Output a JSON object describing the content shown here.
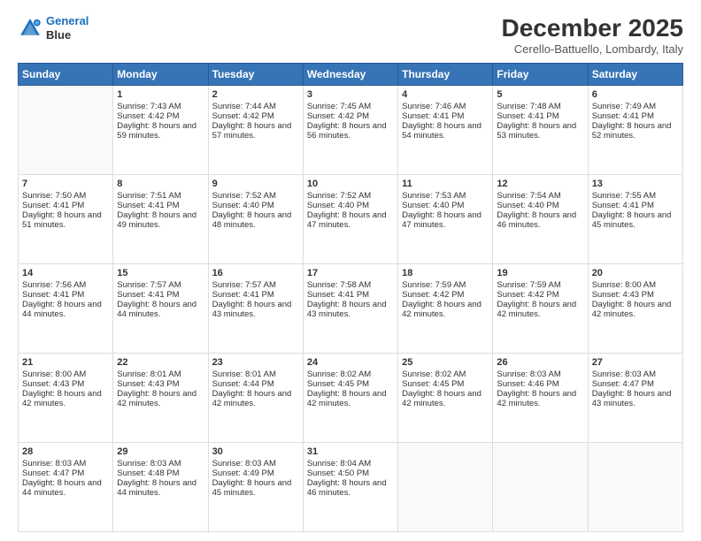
{
  "logo": {
    "line1": "General",
    "line2": "Blue"
  },
  "title": "December 2025",
  "location": "Cerello-Battuello, Lombardy, Italy",
  "days_of_week": [
    "Sunday",
    "Monday",
    "Tuesday",
    "Wednesday",
    "Thursday",
    "Friday",
    "Saturday"
  ],
  "weeks": [
    [
      {
        "day": "",
        "empty": true,
        "sunrise": "",
        "sunset": "",
        "daylight": ""
      },
      {
        "day": "1",
        "sunrise": "Sunrise: 7:43 AM",
        "sunset": "Sunset: 4:42 PM",
        "daylight": "Daylight: 8 hours and 59 minutes."
      },
      {
        "day": "2",
        "sunrise": "Sunrise: 7:44 AM",
        "sunset": "Sunset: 4:42 PM",
        "daylight": "Daylight: 8 hours and 57 minutes."
      },
      {
        "day": "3",
        "sunrise": "Sunrise: 7:45 AM",
        "sunset": "Sunset: 4:42 PM",
        "daylight": "Daylight: 8 hours and 56 minutes."
      },
      {
        "day": "4",
        "sunrise": "Sunrise: 7:46 AM",
        "sunset": "Sunset: 4:41 PM",
        "daylight": "Daylight: 8 hours and 54 minutes."
      },
      {
        "day": "5",
        "sunrise": "Sunrise: 7:48 AM",
        "sunset": "Sunset: 4:41 PM",
        "daylight": "Daylight: 8 hours and 53 minutes."
      },
      {
        "day": "6",
        "sunrise": "Sunrise: 7:49 AM",
        "sunset": "Sunset: 4:41 PM",
        "daylight": "Daylight: 8 hours and 52 minutes."
      }
    ],
    [
      {
        "day": "7",
        "sunrise": "Sunrise: 7:50 AM",
        "sunset": "Sunset: 4:41 PM",
        "daylight": "Daylight: 8 hours and 51 minutes."
      },
      {
        "day": "8",
        "sunrise": "Sunrise: 7:51 AM",
        "sunset": "Sunset: 4:41 PM",
        "daylight": "Daylight: 8 hours and 49 minutes."
      },
      {
        "day": "9",
        "sunrise": "Sunrise: 7:52 AM",
        "sunset": "Sunset: 4:40 PM",
        "daylight": "Daylight: 8 hours and 48 minutes."
      },
      {
        "day": "10",
        "sunrise": "Sunrise: 7:52 AM",
        "sunset": "Sunset: 4:40 PM",
        "daylight": "Daylight: 8 hours and 47 minutes."
      },
      {
        "day": "11",
        "sunrise": "Sunrise: 7:53 AM",
        "sunset": "Sunset: 4:40 PM",
        "daylight": "Daylight: 8 hours and 47 minutes."
      },
      {
        "day": "12",
        "sunrise": "Sunrise: 7:54 AM",
        "sunset": "Sunset: 4:40 PM",
        "daylight": "Daylight: 8 hours and 46 minutes."
      },
      {
        "day": "13",
        "sunrise": "Sunrise: 7:55 AM",
        "sunset": "Sunset: 4:41 PM",
        "daylight": "Daylight: 8 hours and 45 minutes."
      }
    ],
    [
      {
        "day": "14",
        "sunrise": "Sunrise: 7:56 AM",
        "sunset": "Sunset: 4:41 PM",
        "daylight": "Daylight: 8 hours and 44 minutes."
      },
      {
        "day": "15",
        "sunrise": "Sunrise: 7:57 AM",
        "sunset": "Sunset: 4:41 PM",
        "daylight": "Daylight: 8 hours and 44 minutes."
      },
      {
        "day": "16",
        "sunrise": "Sunrise: 7:57 AM",
        "sunset": "Sunset: 4:41 PM",
        "daylight": "Daylight: 8 hours and 43 minutes."
      },
      {
        "day": "17",
        "sunrise": "Sunrise: 7:58 AM",
        "sunset": "Sunset: 4:41 PM",
        "daylight": "Daylight: 8 hours and 43 minutes."
      },
      {
        "day": "18",
        "sunrise": "Sunrise: 7:59 AM",
        "sunset": "Sunset: 4:42 PM",
        "daylight": "Daylight: 8 hours and 42 minutes."
      },
      {
        "day": "19",
        "sunrise": "Sunrise: 7:59 AM",
        "sunset": "Sunset: 4:42 PM",
        "daylight": "Daylight: 8 hours and 42 minutes."
      },
      {
        "day": "20",
        "sunrise": "Sunrise: 8:00 AM",
        "sunset": "Sunset: 4:43 PM",
        "daylight": "Daylight: 8 hours and 42 minutes."
      }
    ],
    [
      {
        "day": "21",
        "sunrise": "Sunrise: 8:00 AM",
        "sunset": "Sunset: 4:43 PM",
        "daylight": "Daylight: 8 hours and 42 minutes."
      },
      {
        "day": "22",
        "sunrise": "Sunrise: 8:01 AM",
        "sunset": "Sunset: 4:43 PM",
        "daylight": "Daylight: 8 hours and 42 minutes."
      },
      {
        "day": "23",
        "sunrise": "Sunrise: 8:01 AM",
        "sunset": "Sunset: 4:44 PM",
        "daylight": "Daylight: 8 hours and 42 minutes."
      },
      {
        "day": "24",
        "sunrise": "Sunrise: 8:02 AM",
        "sunset": "Sunset: 4:45 PM",
        "daylight": "Daylight: 8 hours and 42 minutes."
      },
      {
        "day": "25",
        "sunrise": "Sunrise: 8:02 AM",
        "sunset": "Sunset: 4:45 PM",
        "daylight": "Daylight: 8 hours and 42 minutes."
      },
      {
        "day": "26",
        "sunrise": "Sunrise: 8:03 AM",
        "sunset": "Sunset: 4:46 PM",
        "daylight": "Daylight: 8 hours and 42 minutes."
      },
      {
        "day": "27",
        "sunrise": "Sunrise: 8:03 AM",
        "sunset": "Sunset: 4:47 PM",
        "daylight": "Daylight: 8 hours and 43 minutes."
      }
    ],
    [
      {
        "day": "28",
        "sunrise": "Sunrise: 8:03 AM",
        "sunset": "Sunset: 4:47 PM",
        "daylight": "Daylight: 8 hours and 44 minutes."
      },
      {
        "day": "29",
        "sunrise": "Sunrise: 8:03 AM",
        "sunset": "Sunset: 4:48 PM",
        "daylight": "Daylight: 8 hours and 44 minutes."
      },
      {
        "day": "30",
        "sunrise": "Sunrise: 8:03 AM",
        "sunset": "Sunset: 4:49 PM",
        "daylight": "Daylight: 8 hours and 45 minutes."
      },
      {
        "day": "31",
        "sunrise": "Sunrise: 8:04 AM",
        "sunset": "Sunset: 4:50 PM",
        "daylight": "Daylight: 8 hours and 46 minutes."
      },
      {
        "day": "",
        "empty": true,
        "sunrise": "",
        "sunset": "",
        "daylight": ""
      },
      {
        "day": "",
        "empty": true,
        "sunrise": "",
        "sunset": "",
        "daylight": ""
      },
      {
        "day": "",
        "empty": true,
        "sunrise": "",
        "sunset": "",
        "daylight": ""
      }
    ]
  ]
}
